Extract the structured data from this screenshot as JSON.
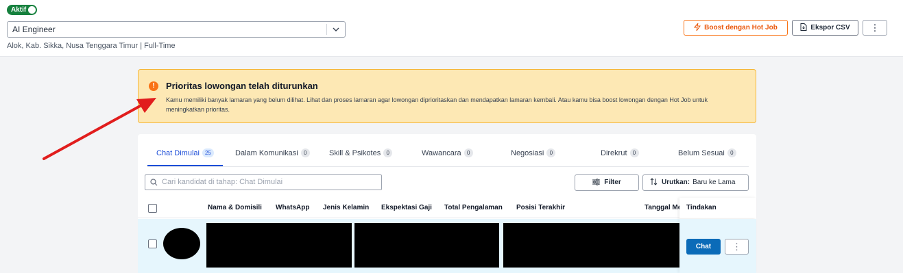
{
  "header": {
    "status_badge": "Aktif",
    "job_select_value": "AI Engineer",
    "location": "Alok, Kab. Sikka, Nusa Tenggara Timur | Full-Time",
    "boost_label": "Boost dengan Hot Job",
    "export_label": "Ekspor CSV",
    "more_label": "⋮"
  },
  "alert": {
    "title": "Prioritas lowongan telah diturunkan",
    "body": "Kamu memiliki banyak lamaran yang belum dilihat. Lihat dan proses lamaran agar lowongan diprioritaskan dan mendapatkan lamaran kembali. Atau kamu bisa boost lowongan dengan Hot Job untuk meningkatkan prioritas."
  },
  "tabs": [
    {
      "label": "Chat Dimulai",
      "count": "25"
    },
    {
      "label": "Dalam Komunikasi",
      "count": "0"
    },
    {
      "label": "Skill & Psikotes",
      "count": "0"
    },
    {
      "label": "Wawancara",
      "count": "0"
    },
    {
      "label": "Negosiasi",
      "count": "0"
    },
    {
      "label": "Direkrut",
      "count": "0"
    },
    {
      "label": "Belum Sesuai",
      "count": "0"
    }
  ],
  "search": {
    "placeholder": "Cari kandidat di tahap: Chat Dimulai"
  },
  "filter_label": "Filter",
  "sort": {
    "label": "Urutkan:",
    "value": "Baru ke Lama"
  },
  "table": {
    "columns": [
      "Nama & Domisili",
      "WhatsApp",
      "Jenis Kelamin",
      "Ekspektasi Gaji",
      "Total Pengalaman",
      "Posisi Terakhir",
      "Tanggal Me",
      "Tindakan"
    ]
  },
  "row": {
    "chat_label": "Chat",
    "more_label": "⋮"
  },
  "colors": {
    "accent": "#1d4ed8",
    "warning_bg": "#fde8b4",
    "boost": "#ea580c",
    "active_badge": "#15803d",
    "arrow": "#e11d1d"
  }
}
